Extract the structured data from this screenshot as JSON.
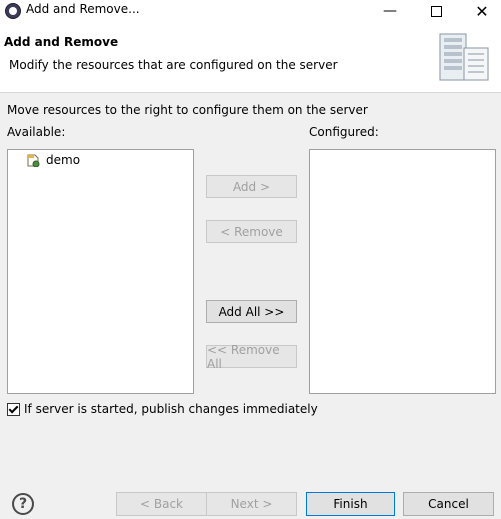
{
  "window": {
    "title": "Add and Remove...",
    "minimize_glyph": "—",
    "close_glyph": "✕"
  },
  "banner": {
    "title": "Add and Remove",
    "description": "Modify the resources that are configured on the server"
  },
  "content": {
    "instruction": "Move resources to the right to configure them on the server",
    "available_label": "Available:",
    "configured_label": "Configured:",
    "available_items": [
      {
        "label": "demo",
        "icon": "project-icon"
      }
    ],
    "configured_items": []
  },
  "buttons": {
    "add": "Add >",
    "remove": "< Remove",
    "add_all": "Add All >>",
    "remove_all": "<< Remove All",
    "back": "< Back",
    "next": "Next >",
    "finish": "Finish",
    "cancel": "Cancel",
    "help": "?"
  },
  "checkbox": {
    "label": "If server is started, publish changes immediately",
    "checked": true
  },
  "colors": {
    "focus_border": "#0078d7",
    "disabled_text": "#a0a0a0"
  }
}
